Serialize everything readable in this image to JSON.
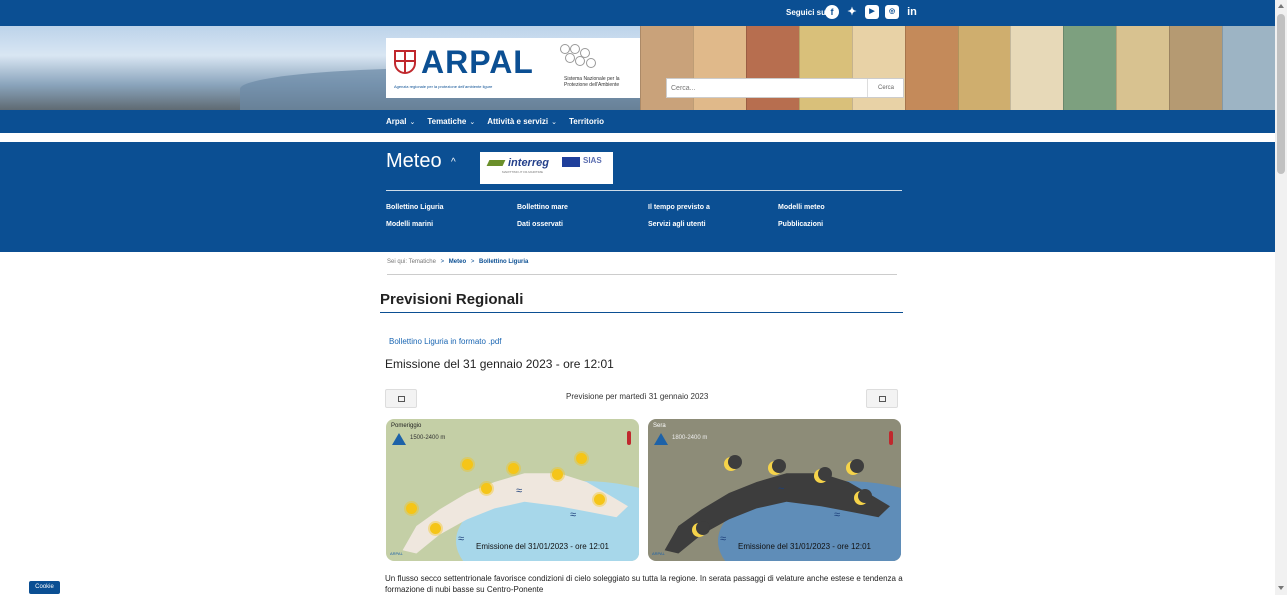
{
  "header": {
    "follow_label": "Seguici su:",
    "social_icons": [
      "facebook-icon",
      "twitter-icon",
      "youtube-icon",
      "instagram-icon",
      "linkedin-icon"
    ],
    "logo_text": "ARPAL",
    "logo_subtitle": "Agenzia regionale per la protezione dell'ambiente ligure",
    "snpa_text": "Sistema Nazionale per la Protezione dell'Ambiente",
    "search_placeholder": "Cerca...",
    "search_button": "Cerca"
  },
  "nav": {
    "items": [
      {
        "label": "Arpal",
        "caret": "⌄"
      },
      {
        "label": "Tematiche",
        "caret": "⌄"
      },
      {
        "label": "Attività e servizi",
        "caret": "⌄"
      },
      {
        "label": "Territorio",
        "caret": ""
      }
    ]
  },
  "meteo": {
    "title": "Meteo",
    "caret": "^",
    "interreg_text": "interreg",
    "interreg_badge": "SIAS",
    "interreg_subtitle": "MARITTIMO-IT FR-MARITIME",
    "links": [
      "Bollettino Liguria",
      "Bollettino mare",
      "Il tempo previsto a",
      "Modelli meteo",
      "Modelli marini",
      "Dati osservati",
      "Servizi agli utenti",
      "Pubblicazioni"
    ]
  },
  "breadcrumb": {
    "prefix": "Sei qui:",
    "items": [
      "Tematiche",
      "Meteo",
      "Bollettino Liguria"
    ],
    "separator": ">"
  },
  "content": {
    "title": "Previsioni Regionali",
    "pdf_link": "Bollettino Liguria in formato .pdf",
    "emission": "Emissione del 31 gennaio 2023 - ore 12:01",
    "forecast_label": "Previsione per martedì 31 gennaio 2023",
    "maps": [
      {
        "period": "Pomeriggio",
        "altitude": "1500-2400 m",
        "emission": "Emissione del 31/01/2023 - ore 12:01",
        "logo": "ARPAL"
      },
      {
        "period": "Sera",
        "altitude": "1800-2400 m",
        "emission": "Emissione del 31/01/2023 - ore 12:01",
        "logo": "ARPAL"
      }
    ],
    "summary": "Un flusso secco settentrionale favorisce condizioni di cielo soleggiato su tutta la regione. In serata passaggi di velature anche estese e tendenza a formazione di nubi basse su Centro-Ponente"
  },
  "cookie_label": "Cookie",
  "colors": {
    "brand": "#0b4f93",
    "link": "#1a66b3"
  }
}
